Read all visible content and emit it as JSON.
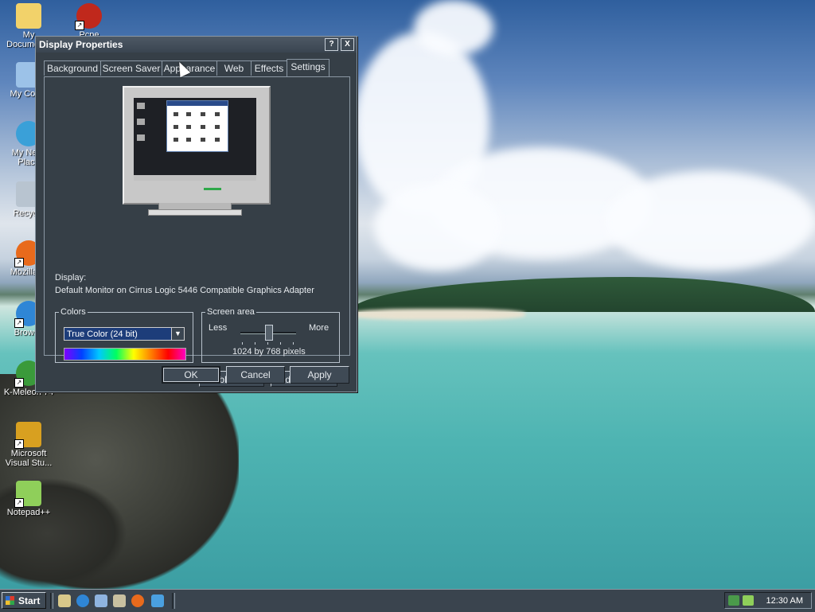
{
  "desktop": {
    "icons": [
      {
        "label": "My Documents",
        "icon": "folder-icon",
        "color": "#f2d26a"
      },
      {
        "label": "Pcpe",
        "icon": "app-icon",
        "color": "#c0281c"
      },
      {
        "label": "My Comp",
        "icon": "computer-icon",
        "color": "#9cc2e8"
      },
      {
        "label": "My Netw Place",
        "icon": "network-places-icon",
        "color": "#3aa0d8"
      },
      {
        "label": "Recycle",
        "icon": "recycle-bin-icon",
        "color": "#b8c4d0"
      },
      {
        "label": "Mozilla Fi",
        "icon": "firefox-icon",
        "color": "#e86a1c"
      },
      {
        "label": "Browse",
        "icon": "browser-icon",
        "color": "#2f86d6"
      },
      {
        "label": "K-Meleon 74",
        "icon": "kmeleon-icon",
        "color": "#3a9a3a"
      },
      {
        "label": "Microsoft Visual Stu...",
        "icon": "visual-studio-icon",
        "color": "#d8a020"
      },
      {
        "label": "Notepad++",
        "icon": "notepadpp-icon",
        "color": "#8fcf5a"
      }
    ]
  },
  "dialog": {
    "title": "Display Properties",
    "help_button": "?",
    "close_button": "X",
    "tabs": [
      {
        "label": "Background"
      },
      {
        "label": "Screen Saver"
      },
      {
        "label": "Appearance"
      },
      {
        "label": "Web"
      },
      {
        "label": "Effects"
      },
      {
        "label": "Settings",
        "active": true
      }
    ],
    "display_label": "Display:",
    "display_value": "Default Monitor on Cirrus Logic 5446 Compatible Graphics Adapter",
    "colors": {
      "legend": "Colors",
      "selected": "True Color (24 bit)"
    },
    "screen_area": {
      "legend": "Screen area",
      "less": "Less",
      "more": "More",
      "resolution": "1024 by 768 pixels",
      "slider_fraction": 0.5
    },
    "troubleshoot_button": "Troubleshoot...",
    "advanced_button": "Advanced...",
    "ok_button": "OK",
    "cancel_button": "Cancel",
    "apply_button": "Apply"
  },
  "taskbar": {
    "start_label": "Start",
    "clock": "12:30 AM",
    "quick_launch": [
      "show-desktop-icon",
      "internet-explorer-icon",
      "outlook-express-icon",
      "search-icon",
      "firefox-icon",
      "messenger-icon"
    ]
  },
  "colors": {
    "dialog_bg": "#363f47",
    "selection": "#1d3d7a",
    "taskbar": "#3a444e"
  }
}
